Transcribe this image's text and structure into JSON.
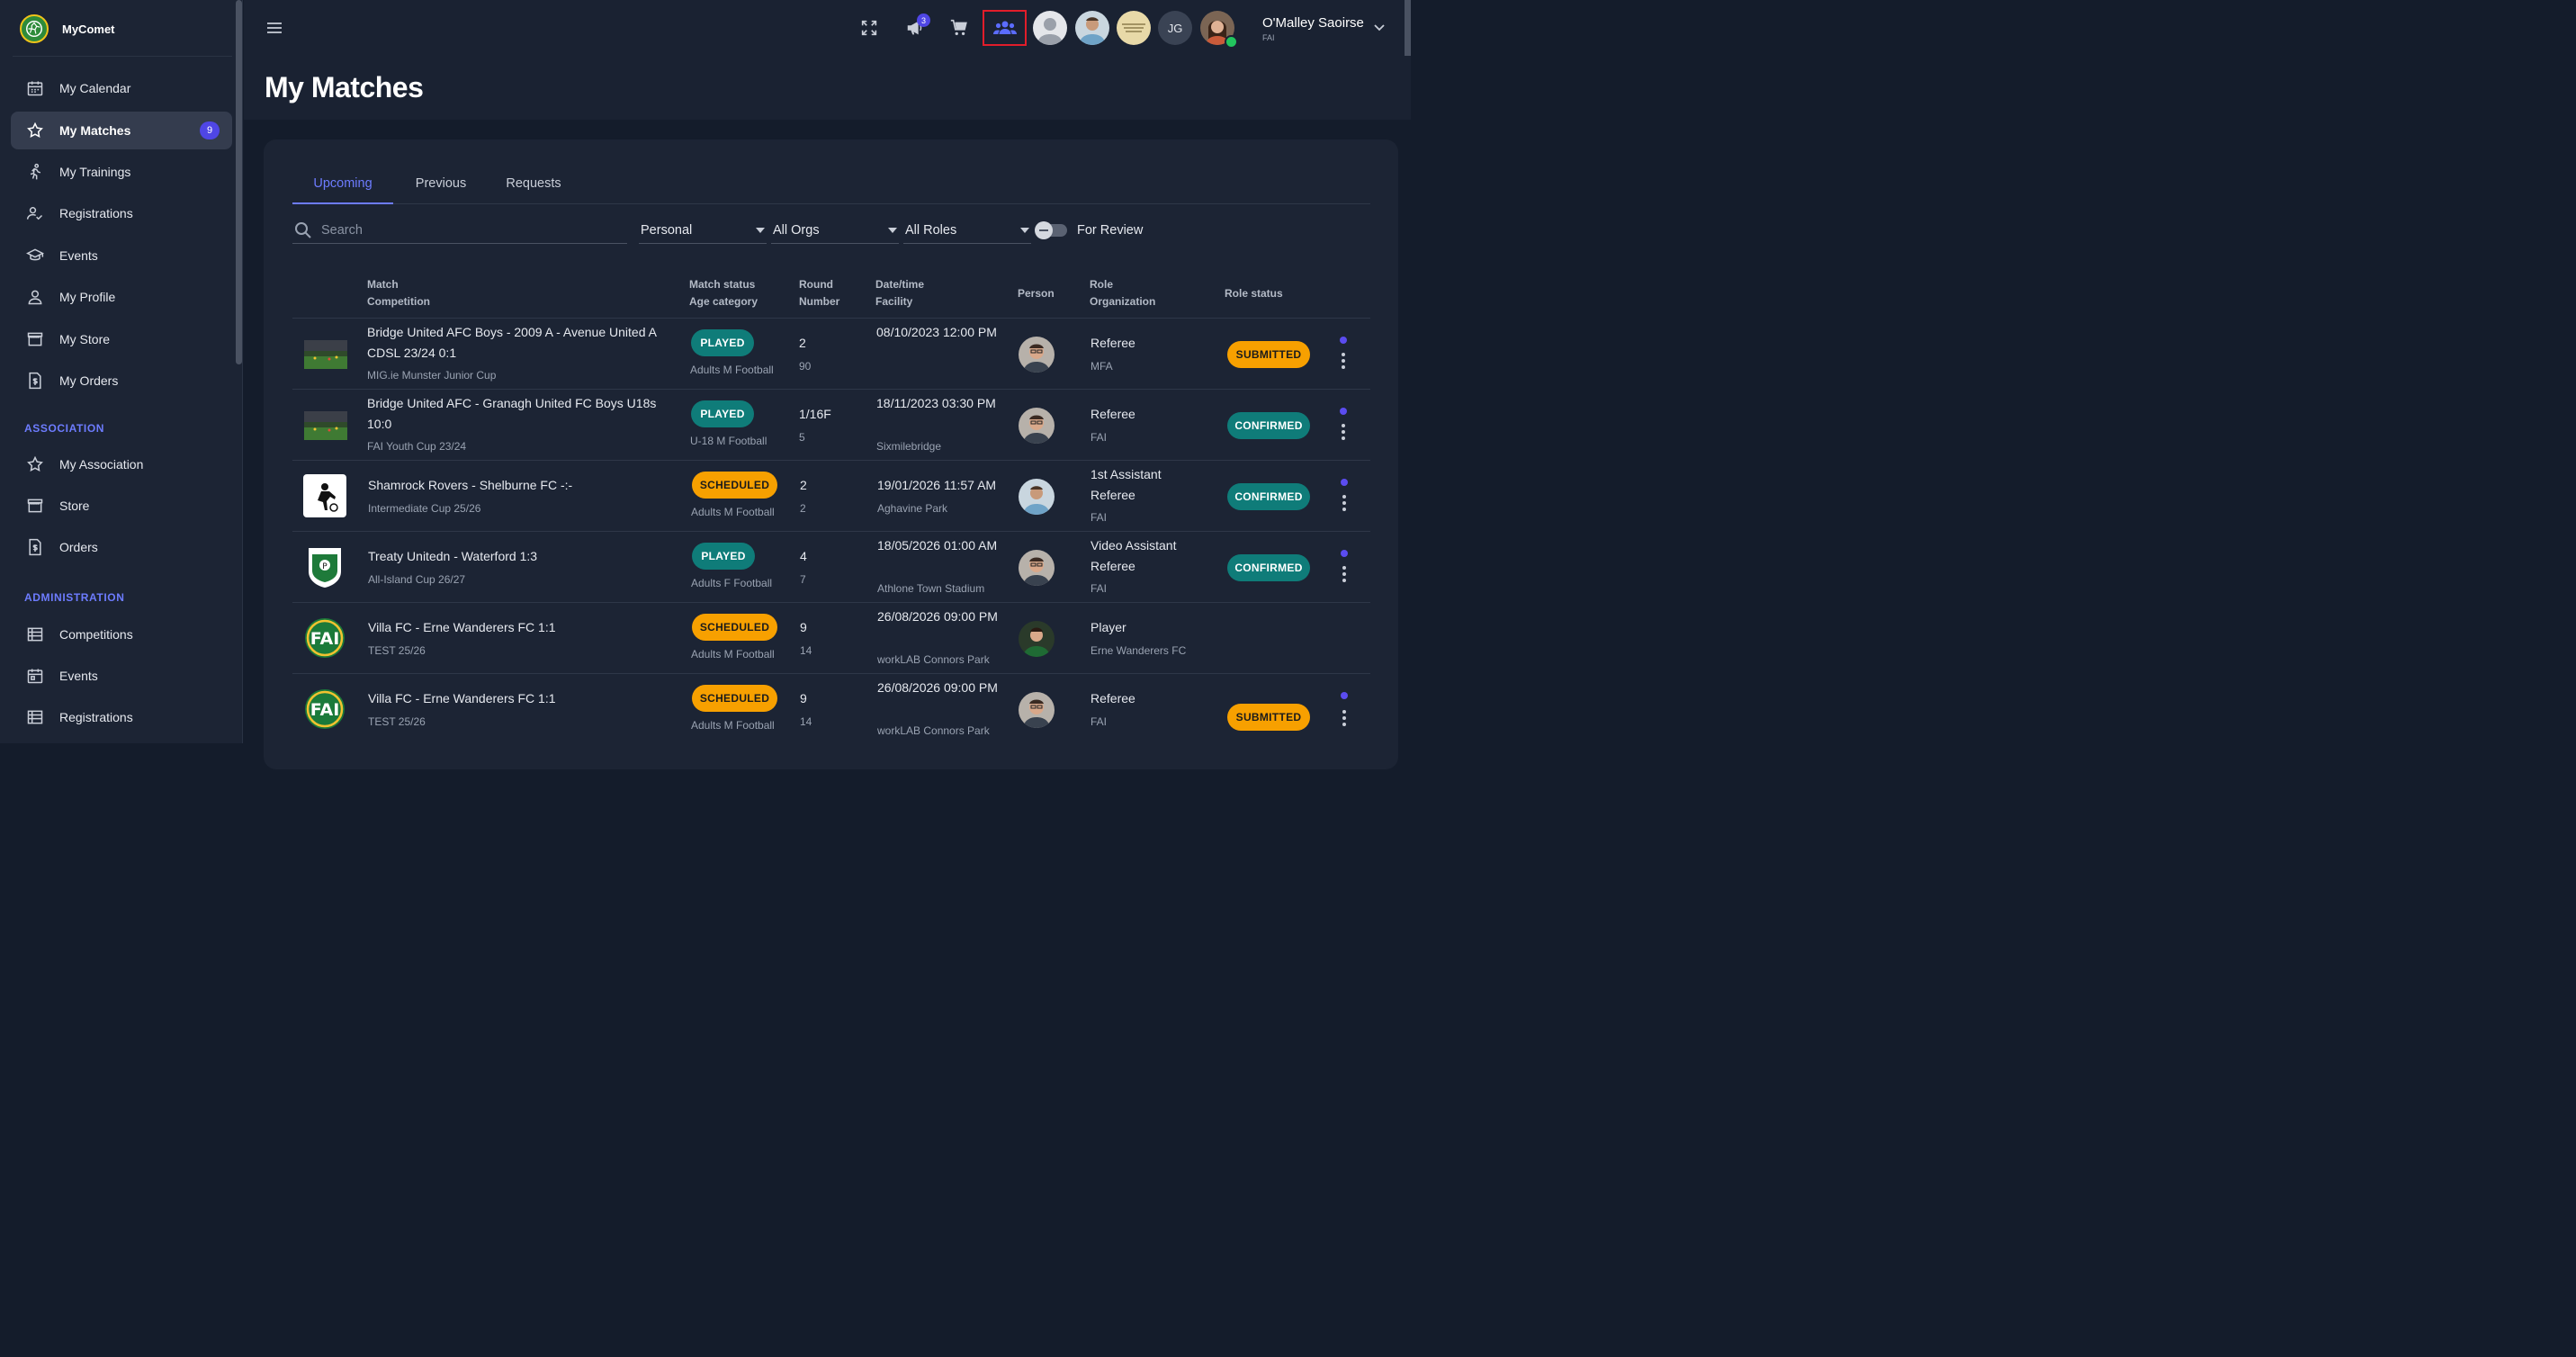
{
  "app": {
    "name": "MyComet"
  },
  "sidebar": {
    "items": [
      {
        "label": "My Calendar",
        "icon": "calendar-icon"
      },
      {
        "label": "My Matches",
        "icon": "star-icon",
        "badge": "9",
        "active": true
      },
      {
        "label": "My Trainings",
        "icon": "running-icon"
      },
      {
        "label": "Registrations",
        "icon": "person-check-icon"
      },
      {
        "label": "Events",
        "icon": "graduation-cap-icon"
      },
      {
        "label": "My Profile",
        "icon": "person-icon"
      },
      {
        "label": "My Store",
        "icon": "store-icon"
      },
      {
        "label": "My Orders",
        "icon": "invoice-icon"
      }
    ],
    "association_title": "ASSOCIATION",
    "association_items": [
      {
        "label": "My Association",
        "icon": "star-outline-icon"
      },
      {
        "label": "Store",
        "icon": "store-icon"
      },
      {
        "label": "Orders",
        "icon": "invoice-icon"
      }
    ],
    "administration_title": "ADMINISTRATION",
    "administration_items": [
      {
        "label": "Competitions",
        "icon": "list-icon"
      },
      {
        "label": "Events",
        "icon": "calendar-icon"
      },
      {
        "label": "Registrations",
        "icon": "list-icon"
      }
    ]
  },
  "topbar": {
    "notifications_count": "3",
    "avatar_initials": "JG",
    "user_name": "O'Malley Saoirse",
    "user_org": "FAI",
    "accent": "#5b6cff",
    "highlight": "#e11d2a"
  },
  "page": {
    "title": "My Matches"
  },
  "tabs": [
    "Upcoming",
    "Previous",
    "Requests"
  ],
  "filters": {
    "search_placeholder": "Search",
    "scope": "Personal",
    "orgs": "All Orgs",
    "roles": "All Roles",
    "for_review_label": "For Review"
  },
  "table": {
    "headers": {
      "match": "Match",
      "competition": "Competition",
      "match_status": "Match status",
      "age_category": "Age category",
      "round": "Round",
      "number": "Number",
      "datetime": "Date/time",
      "facility": "Facility",
      "person": "Person",
      "role": "Role",
      "organization": "Organization",
      "role_status": "Role status"
    },
    "rows": [
      {
        "match": "Bridge United AFC Boys - 2009 A - Avenue United A CDSL 23/24 0:1",
        "competition": "MIG.ie Munster Junior Cup",
        "status": "PLAYED",
        "age": "Adults M Football",
        "round": "2",
        "number": "90",
        "datetime": "08/10/2023 12:00 PM",
        "facility": "",
        "role": "Referee",
        "org": "MFA",
        "role_status": "SUBMITTED"
      },
      {
        "match": "Bridge United AFC - Granagh United FC Boys U18s 10:0",
        "competition": "FAI Youth Cup 23/24",
        "status": "PLAYED",
        "age": "U-18 M Football",
        "round": "1/16F",
        "number": "5",
        "datetime": "18/11/2023 03:30 PM",
        "facility": "Sixmilebridge",
        "role": "Referee",
        "org": "FAI",
        "role_status": "CONFIRMED"
      },
      {
        "match": "Shamrock Rovers - Shelburne FC -:-",
        "competition": "Intermediate Cup 25/26",
        "status": "SCHEDULED",
        "age": "Adults M Football",
        "round": "2",
        "number": "2",
        "datetime": "19/01/2026 11:57 AM",
        "facility": "Aghavine Park",
        "role": "1st Assistant Referee",
        "org": "FAI",
        "role_status": "CONFIRMED"
      },
      {
        "match": "Treaty Unitedn - Waterford 1:3",
        "competition": "All-Island Cup 26/27",
        "status": "PLAYED",
        "age": "Adults F Football",
        "round": "4",
        "number": "7",
        "datetime": "18/05/2026 01:00 AM",
        "facility": "Athlone Town Stadium",
        "role": "Video Assistant Referee",
        "org": "FAI",
        "role_status": "CONFIRMED"
      },
      {
        "match": "Villa FC - Erne Wanderers FC 1:1",
        "competition": "TEST 25/26",
        "status": "SCHEDULED",
        "age": "Adults M Football",
        "round": "9",
        "number": "14",
        "datetime": "26/08/2026 09:00 PM",
        "facility": "workLAB Connors Park",
        "role": "Player",
        "org": "Erne Wanderers FC",
        "role_status": ""
      },
      {
        "match": "Villa FC - Erne Wanderers FC 1:1",
        "competition": "TEST 25/26",
        "status": "SCHEDULED",
        "age": "Adults M Football",
        "round": "9",
        "number": "14",
        "datetime": "26/08/2026 09:00 PM",
        "facility": "workLAB Connors Park",
        "role": "Referee",
        "org": "FAI",
        "role_status": "SUBMITTED"
      }
    ]
  }
}
